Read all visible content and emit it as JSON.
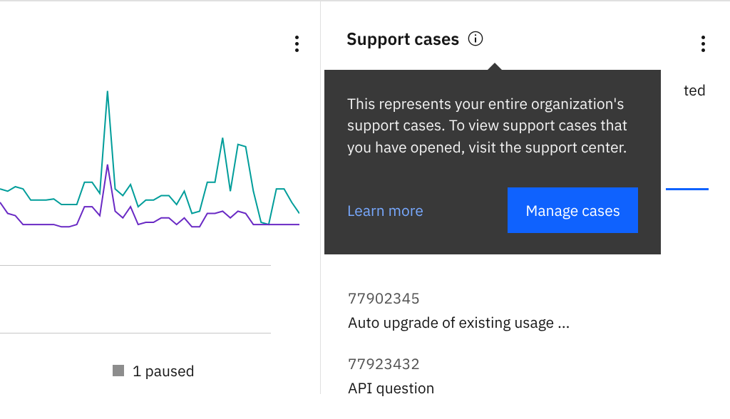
{
  "left_panel": {
    "legend": {
      "label": "1 paused"
    }
  },
  "right_panel": {
    "title": "Support cases",
    "truncated_tab": "ted"
  },
  "tooltip": {
    "body": "This represents your entire organization's support cases. To view support cases that you have opened, visit the support center.",
    "learn_more": "Learn more",
    "manage": "Manage cases"
  },
  "cases": [
    {
      "id": "77902345",
      "title": "Auto upgrade of existing usage ..."
    },
    {
      "id": "77923432",
      "title": "API question"
    }
  ],
  "chart_data": {
    "type": "line",
    "x": [
      0,
      1,
      2,
      3,
      4,
      5,
      6,
      7,
      8,
      9,
      10,
      11,
      12,
      13,
      14,
      15,
      16,
      17,
      18,
      19,
      20,
      21,
      22,
      23,
      24,
      25,
      26,
      27,
      28,
      29,
      30,
      31,
      32,
      33,
      34,
      35,
      36,
      37,
      38,
      39
    ],
    "series": [
      {
        "name": "teal",
        "color": "#009d9a",
        "values": [
          62,
          60,
          64,
          62,
          52,
          52,
          52,
          53,
          48,
          48,
          48,
          68,
          68,
          58,
          150,
          62,
          56,
          66,
          46,
          52,
          52,
          56,
          56,
          48,
          60,
          40,
          42,
          68,
          68,
          108,
          60,
          102,
          100,
          60,
          32,
          30,
          62,
          62,
          50,
          40
        ]
      },
      {
        "name": "purple",
        "color": "#6929c4",
        "values": [
          50,
          40,
          38,
          30,
          30,
          30,
          30,
          30,
          28,
          28,
          30,
          46,
          46,
          38,
          84,
          42,
          36,
          46,
          30,
          32,
          32,
          36,
          36,
          30,
          36,
          28,
          28,
          40,
          40,
          42,
          36,
          42,
          40,
          30,
          30,
          30,
          30,
          30,
          30,
          30
        ]
      }
    ],
    "ylim": [
      0,
      160
    ]
  }
}
